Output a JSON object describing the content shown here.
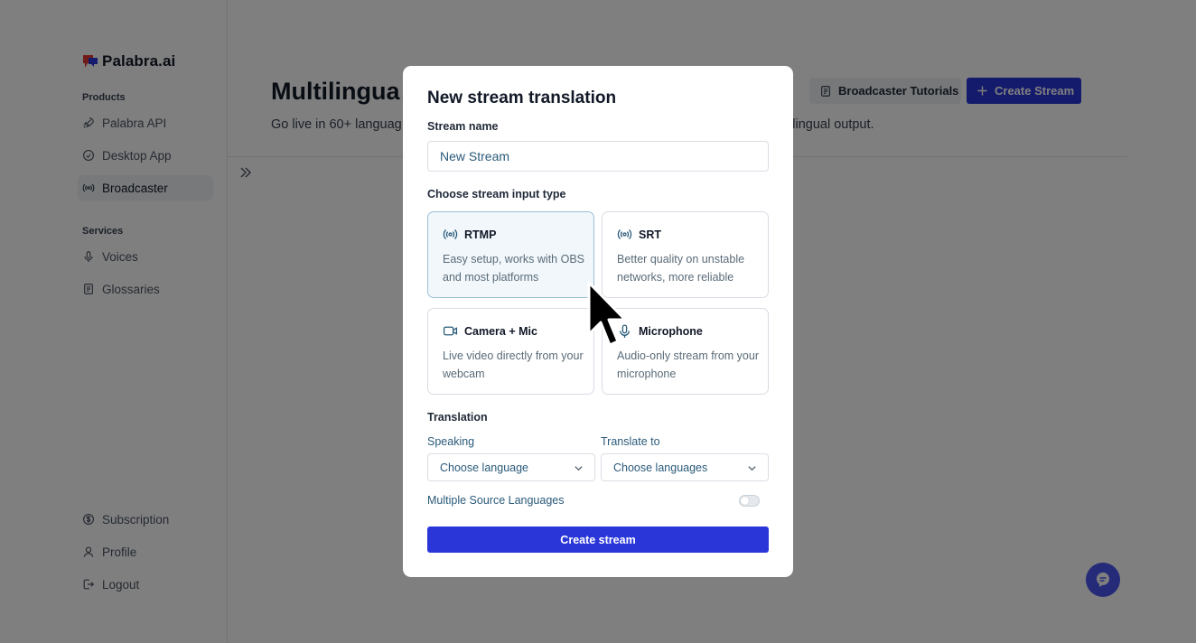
{
  "brand": {
    "name": "Palabra.ai"
  },
  "sidebar": {
    "products_label": "Products",
    "products": [
      {
        "label": "Palabra API",
        "icon": "rocket-icon"
      },
      {
        "label": "Desktop App",
        "icon": "app-icon"
      },
      {
        "label": "Broadcaster",
        "icon": "broadcast-icon",
        "active": true
      }
    ],
    "services_label": "Services",
    "services": [
      {
        "label": "Voices",
        "icon": "microphone-icon"
      },
      {
        "label": "Glossaries",
        "icon": "book-icon"
      }
    ],
    "account": [
      {
        "label": "Subscription",
        "icon": "dollar-icon"
      },
      {
        "label": "Profile",
        "icon": "user-icon"
      },
      {
        "label": "Logout",
        "icon": "logout-icon"
      }
    ]
  },
  "main": {
    "title": "Multilingua",
    "subtitle_left": "Go live in 60+ languag",
    "subtitle_right": "tilingual output.",
    "tutorials_label": "Broadcaster Tutorials",
    "create_label": "Create Stream"
  },
  "modal": {
    "title": "New stream translation",
    "stream_name_label": "Stream name",
    "stream_name_value": "New Stream",
    "input_type_label": "Choose stream input type",
    "input_types": [
      {
        "title": "RTMP",
        "desc": "Easy setup, works with OBS and most platforms",
        "icon": "broadcast-icon",
        "selected": true
      },
      {
        "title": "SRT",
        "desc": "Better quality on unstable networks, more reliable",
        "icon": "broadcast-icon",
        "selected": false
      },
      {
        "title": "Camera + Mic",
        "desc": "Live video directly from your webcam",
        "icon": "camera-icon",
        "selected": false
      },
      {
        "title": "Microphone",
        "desc": "Audio-only stream from your microphone",
        "icon": "microphone-icon",
        "selected": false
      }
    ],
    "translation_label": "Translation",
    "speaking_label": "Speaking",
    "speaking_placeholder": "Choose language",
    "translate_to_label": "Translate to",
    "translate_to_placeholder": "Choose languages",
    "multi_source_label": "Multiple Source Languages",
    "multi_source_enabled": false,
    "submit_label": "Create stream"
  },
  "colors": {
    "primary": "#2b36d9",
    "chat_bubble": "#4b56f0",
    "selected_border": "#9cc0d6",
    "overlay": "rgba(0,0,0,0.5)"
  }
}
